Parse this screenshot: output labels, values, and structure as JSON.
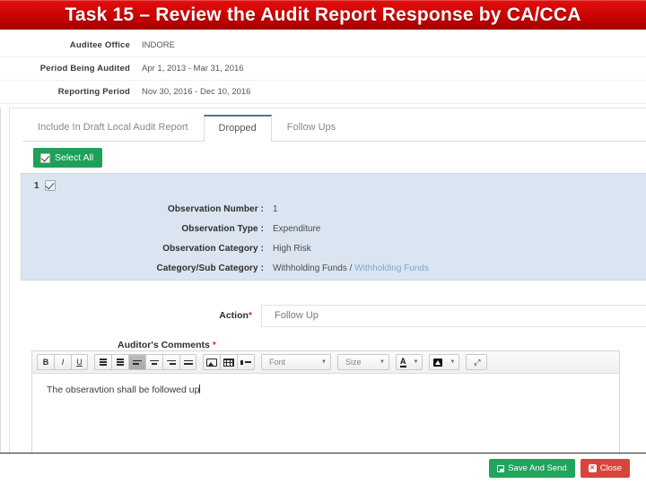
{
  "banner": {
    "title": "Task 15 – Review the Audit Report Response by CA/CCA"
  },
  "meta": {
    "rows": [
      {
        "label": "Auditee Office",
        "value": "INDORE"
      },
      {
        "label": "Period Being Audited",
        "value": "Apr 1, 2013 - Mar 31, 2016"
      },
      {
        "label": "Reporting Period",
        "value": "Nov 30, 2016 - Dec 10, 2016"
      }
    ]
  },
  "tabs": [
    {
      "label": "Include In Draft Local Audit Report",
      "active": false
    },
    {
      "label": "Dropped",
      "active": true
    },
    {
      "label": "Follow Ups",
      "active": false
    }
  ],
  "toolbar": {
    "select_all_label": "Select All",
    "select_all_color": "#1da159"
  },
  "observation": {
    "index": "1",
    "rows": [
      {
        "label": "Observation Number :",
        "value": "1",
        "sub": ""
      },
      {
        "label": "Observation Type :",
        "value": "Expenditure",
        "sub": ""
      },
      {
        "label": "Observation Category :",
        "value": "High Risk",
        "sub": ""
      },
      {
        "label": "Category/Sub Category :",
        "value": "Withholding Funds / ",
        "sub": "Withholding Funds"
      }
    ],
    "panel_bg": "#dbe5f1",
    "sub_color": "#7fa7cf"
  },
  "action": {
    "label": "Action",
    "required_mark": "*",
    "value": "Follow Up"
  },
  "comments": {
    "label": "Auditor's Comments",
    "required_mark": "*",
    "text": "The obseravtion shall be followed up",
    "editor": {
      "bold": "B",
      "italic": "I",
      "underline": "U",
      "font_label": "Font",
      "size_label": "Size",
      "font_caret": "▼",
      "size_caret": "▼",
      "color_caret": "▼",
      "bg_caret": "▼",
      "text_color_glyph": "A",
      "fullscreen_glyph": "⤢"
    }
  },
  "footer": {
    "save_label": "Save And Send",
    "close_label": "Close",
    "close_glyph": "✕",
    "save_color": "#22a45d",
    "close_color": "#d9443c"
  }
}
